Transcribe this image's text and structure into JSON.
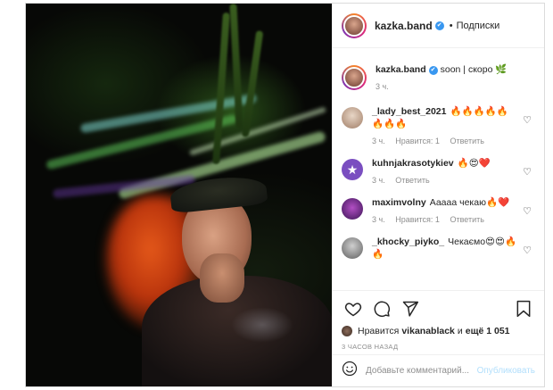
{
  "header": {
    "username": "kazka.band",
    "dot": "•",
    "follow_label": "Подписки"
  },
  "caption": {
    "username": "kazka.band",
    "text": "soon | скоро 🌿",
    "time": "3 ч."
  },
  "comments": [
    {
      "username": "_lady_best_2021",
      "text": "🔥🔥🔥🔥🔥🔥🔥🔥",
      "time": "3 ч.",
      "likes": "Нравится: 1",
      "reply": "Ответить"
    },
    {
      "username": "kuhnjakrasotykiev",
      "text": "🔥😍❤️",
      "time": "3 ч.",
      "reply": "Ответить"
    },
    {
      "username": "maximvolny",
      "text": "Ааааа чекаю🔥❤️",
      "time": "3 ч.",
      "likes": "Нравится: 1",
      "reply": "Ответить"
    },
    {
      "username": "_khocky_piyko_",
      "text": "Чекаємо😍😍🔥🔥",
      "time": "",
      "reply": ""
    }
  ],
  "likes": {
    "prefix": "Нравится",
    "user": "vikanablack",
    "conj": "и",
    "others": "ещё 1 051"
  },
  "timestamp": "3 ЧАСОВ НАЗАД",
  "add_comment": {
    "placeholder": "Добавьте комментарий...",
    "publish_label": "Опубликовать"
  },
  "colors": {
    "verified": "#3897f0",
    "publish_disabled": "#b2dffc",
    "meta_gray": "#8e8e8e"
  },
  "icons": [
    "heart-icon",
    "comment-icon",
    "share-icon",
    "bookmark-icon",
    "emoji-icon",
    "verified-icon",
    "more-icon"
  ]
}
